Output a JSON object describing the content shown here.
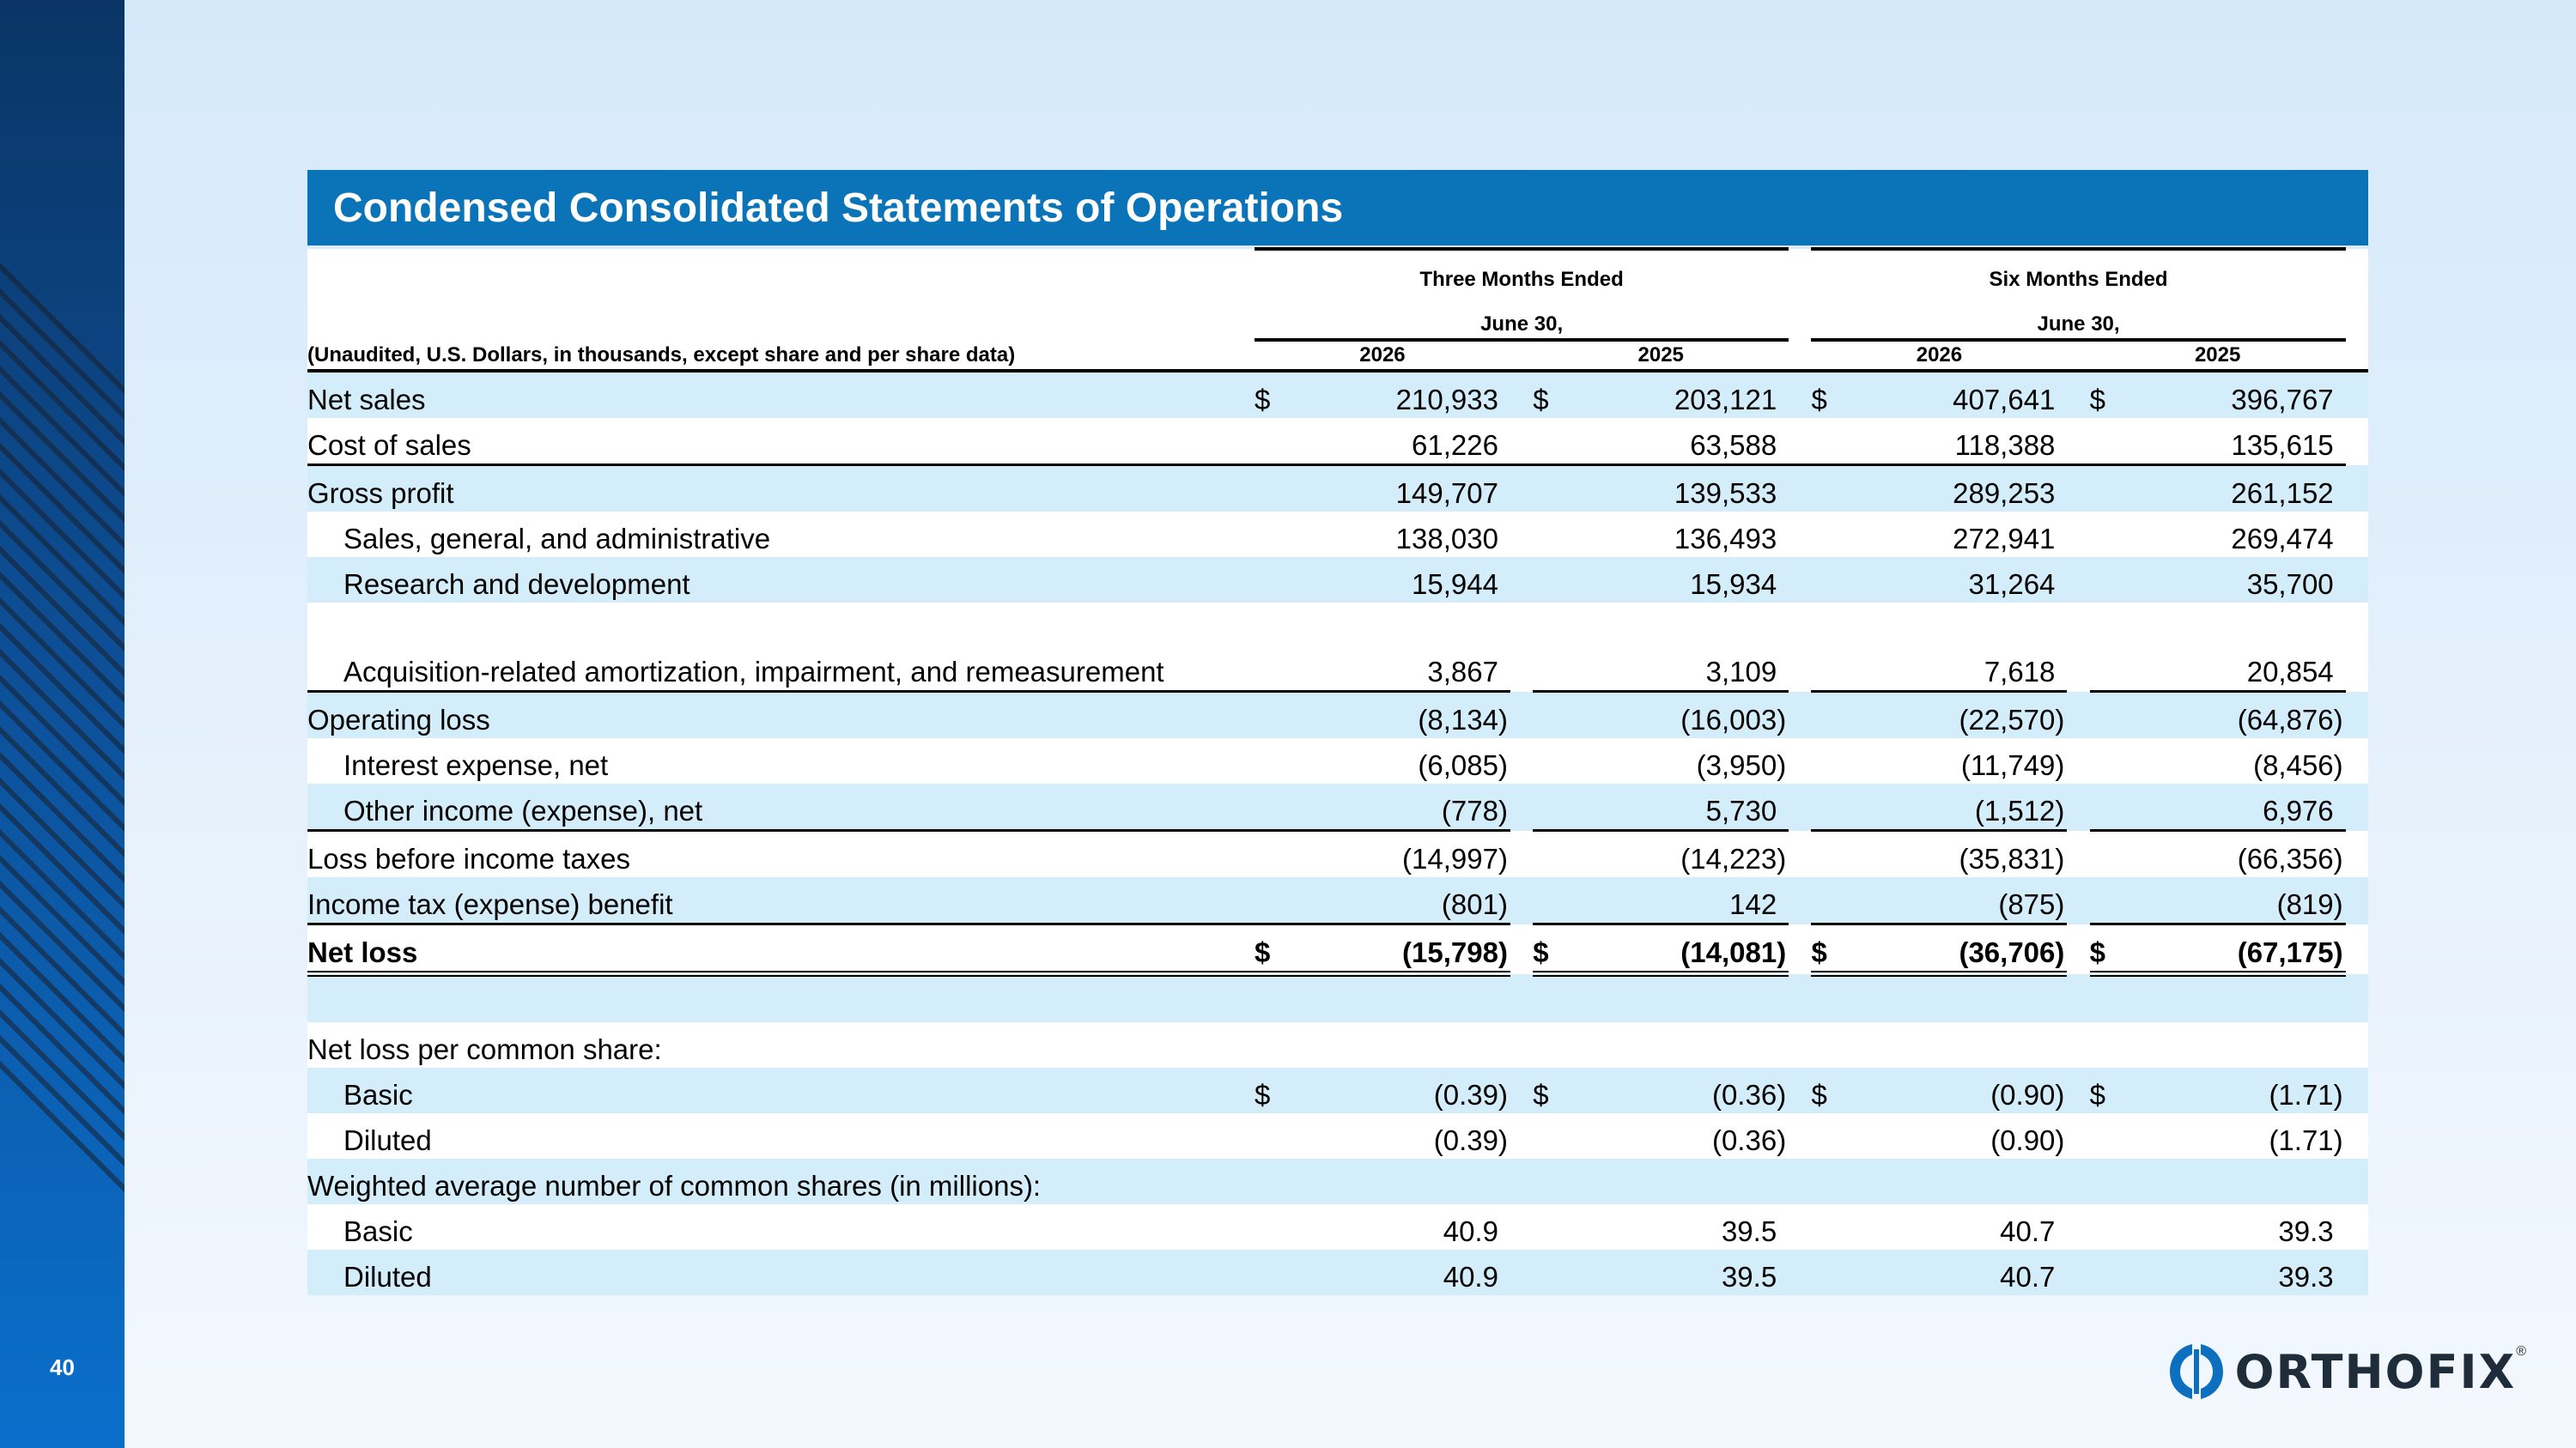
{
  "page_number": "40",
  "title": "Condensed Consolidated Statements of Operations",
  "header": {
    "group_three": "Three Months Ended",
    "group_six": "Six Months Ended",
    "period_end_three": "June 30,",
    "period_end_six": "June 30,",
    "unit_note": "(Unaudited, U.S. Dollars, in thousands, except share and per share data)",
    "years": [
      "2026",
      "2025",
      "2026",
      "2025"
    ]
  },
  "rows": [
    {
      "label": "Net sales",
      "values": [
        "210,933",
        "203,121",
        "407,641",
        "396,767"
      ],
      "dollar": true
    },
    {
      "label": "Cost of sales",
      "values": [
        "61,226",
        "63,588",
        "118,388",
        "135,615"
      ]
    },
    {
      "label": "Gross profit",
      "values": [
        "149,707",
        "139,533",
        "289,253",
        "261,152"
      ]
    },
    {
      "label": "Sales, general, and administrative",
      "values": [
        "138,030",
        "136,493",
        "272,941",
        "269,474"
      ]
    },
    {
      "label": "Research and development",
      "values": [
        "15,944",
        "15,934",
        "31,264",
        "35,700"
      ]
    },
    {
      "label": "Acquisition-related amortization, impairment, and remeasurement",
      "values": [
        "3,867",
        "3,109",
        "7,618",
        "20,854"
      ]
    },
    {
      "label": "Operating loss",
      "values": [
        "(8,134",
        "(16,003",
        "(22,570",
        "(64,876"
      ]
    },
    {
      "label": "Interest expense, net",
      "values": [
        "(6,085",
        "(3,950",
        "(11,749",
        "(8,456"
      ]
    },
    {
      "label": "Other income (expense), net",
      "values": [
        "(778",
        "5,730",
        "(1,512",
        "6,976"
      ]
    },
    {
      "label": "Loss before income taxes",
      "values": [
        "(14,997",
        "(14,223",
        "(35,831",
        "(66,356"
      ]
    },
    {
      "label": "Income tax (expense) benefit",
      "values": [
        "(801",
        "142",
        "(875",
        "(819"
      ]
    },
    {
      "label": "Net loss",
      "values": [
        "(15,798",
        "(14,081",
        "(36,706",
        "(67,175"
      ],
      "dollar": true
    },
    {
      "label": "Net loss per common share:"
    },
    {
      "label": "Basic",
      "values": [
        "(0.39",
        "(0.36",
        "(0.90",
        "(1.71"
      ],
      "dollar": true
    },
    {
      "label": "Diluted",
      "values": [
        "(0.39",
        "(0.36",
        "(0.90",
        "(1.71"
      ]
    },
    {
      "label": "Weighted average number of common shares (in millions):"
    },
    {
      "label": "Basic",
      "values": [
        "40.9",
        "39.5",
        "40.7",
        "39.3"
      ]
    },
    {
      "label": "Diluted",
      "values": [
        "40.9",
        "39.5",
        "40.7",
        "39.3"
      ]
    }
  ],
  "dollar_sign": "$",
  "close_paren": ")",
  "logo": {
    "text": "ORTHOFIX",
    "reg": "®"
  }
}
